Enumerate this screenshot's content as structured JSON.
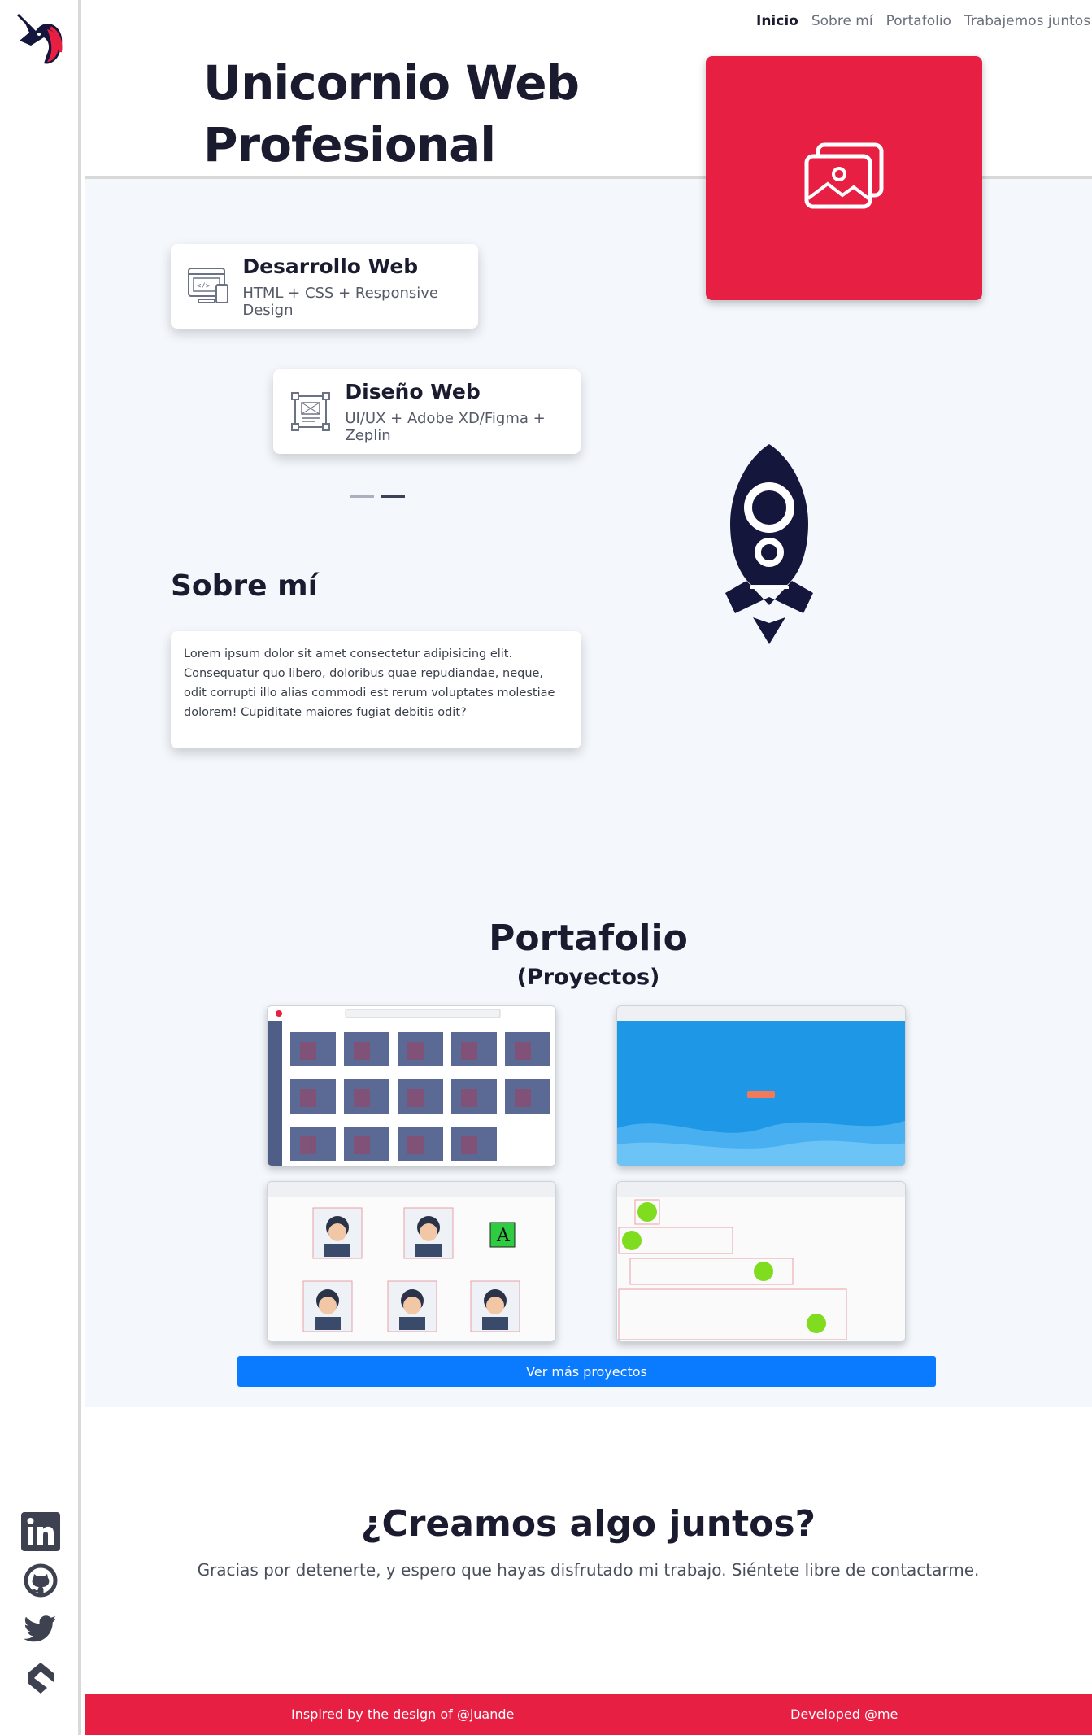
{
  "nav": {
    "items": [
      {
        "label": "Inicio",
        "active": true
      },
      {
        "label": "Sobre mí",
        "active": false
      },
      {
        "label": "Portafolio",
        "active": false
      },
      {
        "label": "Trabajemos juntos",
        "active": false
      }
    ]
  },
  "hero": {
    "title_line1": "Unicornio Web",
    "title_line2": "Profesional",
    "image_icon": "images-icon"
  },
  "services": [
    {
      "title": "Desarrollo Web",
      "subtitle": "HTML + CSS + Responsive Design",
      "icon": "code-window-icon"
    },
    {
      "title": "Diseño Web",
      "subtitle": "UI/UX + Adobe XD/Figma + Zeplin",
      "icon": "layout-frame-icon"
    }
  ],
  "carousel": {
    "active_index": 1,
    "count": 2
  },
  "about": {
    "title": "Sobre mí",
    "text": "Lorem ipsum dolor sit amet consectetur adipisicing elit. Consequatur quo libero, doloribus quae repudiandae, neque, odit corrupti illo alias commodi est rerum voluptates molestiae dolorem! Cupiditate maiores fugiat debitis odit?"
  },
  "portfolio": {
    "title": "Portafolio",
    "subtitle": "(Proyectos)",
    "projects": [
      {
        "name": "movie-gallery-project"
      },
      {
        "name": "blue-landing-project"
      },
      {
        "name": "avatar-grid-project"
      },
      {
        "name": "green-dots-project"
      }
    ],
    "more_button": "Ver más proyectos"
  },
  "cta": {
    "title": "¿Creamos algo juntos?",
    "text": "Gracias por detenerte, y espero que hayas disfrutado mi trabajo. Siéntete libre de contactarme."
  },
  "social": [
    "linkedin-icon",
    "github-icon",
    "twitter-icon",
    "codepen-icon"
  ],
  "footer": {
    "left": "Inspired by the design of @juande",
    "right": "Developed @me"
  },
  "colors": {
    "accent": "#e61f43",
    "dark": "#1b1b2f",
    "button": "#0a7bff",
    "background": "#f4f8fc"
  }
}
